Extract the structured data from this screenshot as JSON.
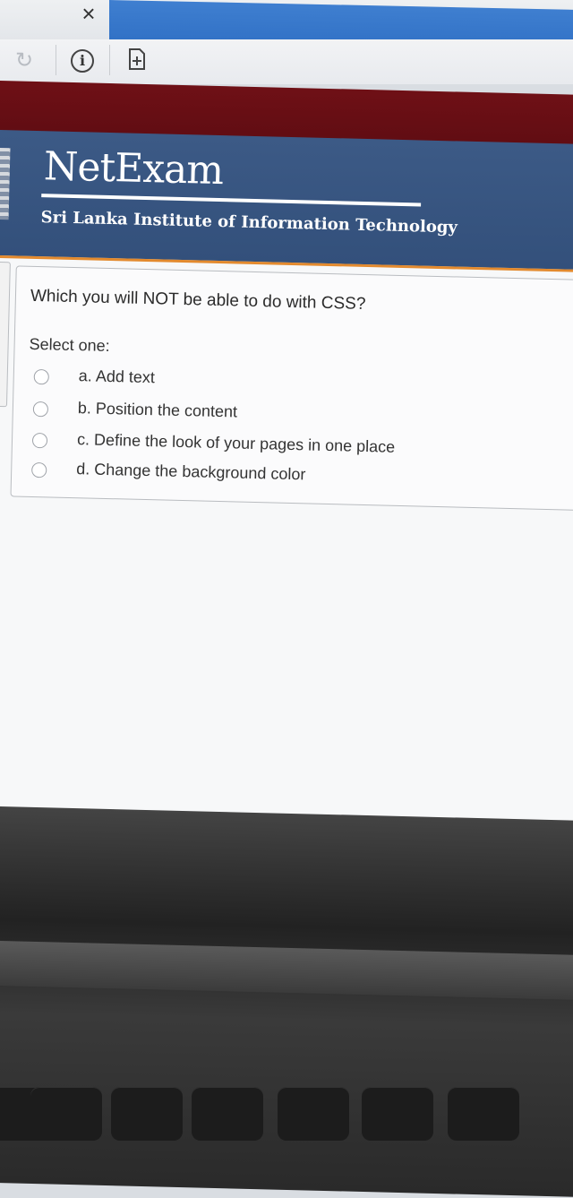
{
  "browser": {
    "close_glyph": "×",
    "reload_icon": "reload-icon",
    "info_glyph": "i",
    "page_icon": "add-page-icon",
    "tab_color": "#3676c8"
  },
  "site": {
    "logo": "NetExam",
    "tagline": "Sri Lanka Institute of Information Technology",
    "header_color": "#385581",
    "band_color": "#66101a",
    "accent_color": "#e38a2e"
  },
  "question": {
    "text": "Which you will NOT be able to do with CSS?",
    "prompt": "Select one:",
    "options": [
      {
        "label": "a. Add text",
        "selected": false
      },
      {
        "label": "b. Position the content",
        "selected": false
      },
      {
        "label": "c. Define the look of your pages in one place",
        "selected": false
      },
      {
        "label": "d. Change the background color",
        "selected": false
      }
    ]
  }
}
